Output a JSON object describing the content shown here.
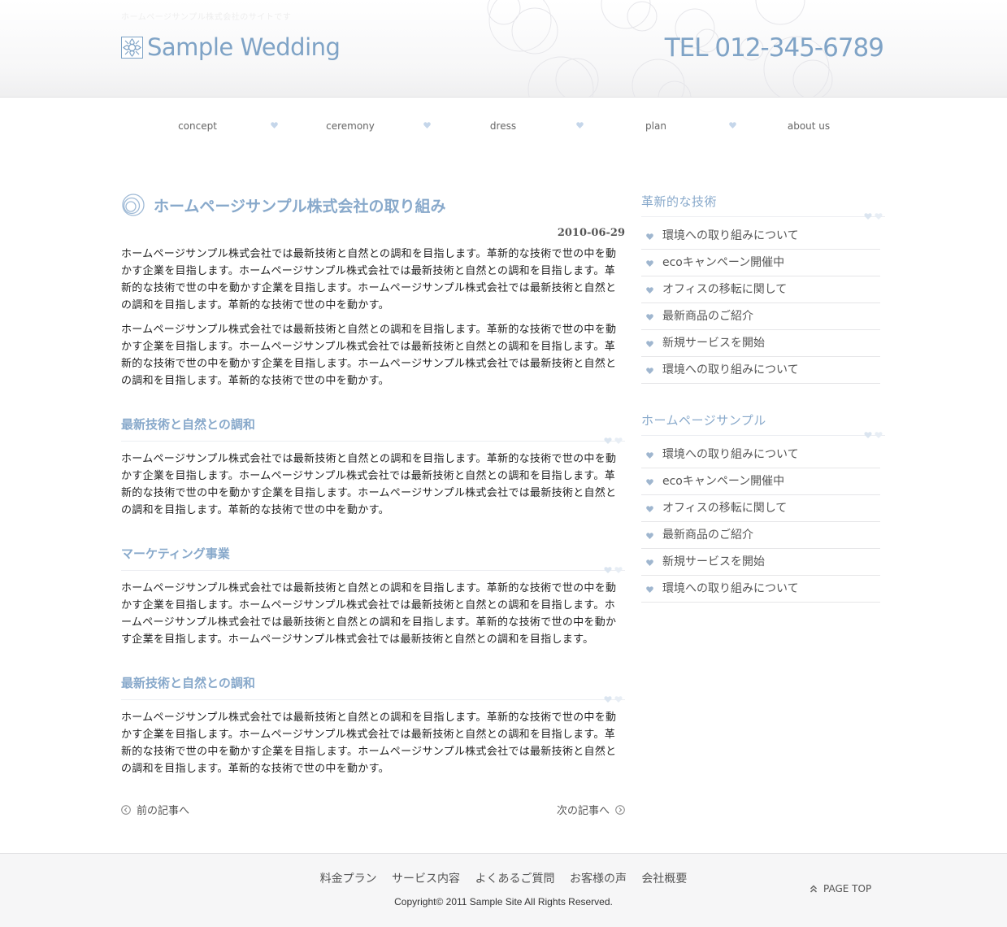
{
  "header": {
    "tagline": "ホームページサンプル株式会社のサイトです",
    "logo_text": "Sample Wedding",
    "tel": "TEL 012-345-6789"
  },
  "nav": {
    "items": [
      {
        "label": "concept"
      },
      {
        "label": "ceremony"
      },
      {
        "label": "dress"
      },
      {
        "label": "plan"
      },
      {
        "label": "about us"
      }
    ]
  },
  "article": {
    "title": "ホームページサンプル株式会社の取り組み",
    "date": "2010-06-29",
    "intro_paragraphs": [
      "ホームページサンプル株式会社では最新技術と自然との調和を目指します。革新的な技術で世の中を動かす企業を目指します。ホームページサンプル株式会社では最新技術と自然との調和を目指します。革新的な技術で世の中を動かす企業を目指します。ホームページサンプル株式会社では最新技術と自然との調和を目指します。革新的な技術で世の中を動かす。",
      "ホームページサンプル株式会社では最新技術と自然との調和を目指します。革新的な技術で世の中を動かす企業を目指します。ホームページサンプル株式会社では最新技術と自然との調和を目指します。革新的な技術で世の中を動かす企業を目指します。ホームページサンプル株式会社では最新技術と自然との調和を目指します。革新的な技術で世の中を動かす。"
    ],
    "sections": [
      {
        "heading": "最新技術と自然との調和",
        "body": "ホームページサンプル株式会社では最新技術と自然との調和を目指します。革新的な技術で世の中を動かす企業を目指します。ホームページサンプル株式会社では最新技術と自然との調和を目指します。革新的な技術で世の中を動かす企業を目指します。ホームページサンプル株式会社では最新技術と自然との調和を目指します。革新的な技術で世の中を動かす。"
      },
      {
        "heading": "マーケティング事業",
        "body": "ホームページサンプル株式会社では最新技術と自然との調和を目指します。革新的な技術で世の中を動かす企業を目指します。ホームページサンプル株式会社では最新技術と自然との調和を目指します。ホームページサンプル株式会社では最新技術と自然との調和を目指します。革新的な技術で世の中を動かす企業を目指します。ホームページサンプル株式会社では最新技術と自然との調和を目指します。"
      },
      {
        "heading": "最新技術と自然との調和",
        "body": "ホームページサンプル株式会社では最新技術と自然との調和を目指します。革新的な技術で世の中を動かす企業を目指します。ホームページサンプル株式会社では最新技術と自然との調和を目指します。革新的な技術で世の中を動かす企業を目指します。ホームページサンプル株式会社では最新技術と自然との調和を目指します。革新的な技術で世の中を動かす。"
      }
    ]
  },
  "pager": {
    "prev_label": "前の記事へ",
    "next_label": "次の記事へ"
  },
  "sidebar": {
    "sections": [
      {
        "heading": "革新的な技術",
        "items": [
          "環境への取り組みについて",
          "ecoキャンペーン開催中",
          "オフィスの移転に関して",
          "最新商品のご紹介",
          "新規サービスを開始",
          "環境への取り組みについて"
        ]
      },
      {
        "heading": "ホームページサンプル",
        "items": [
          "環境への取り組みについて",
          "ecoキャンペーン開催中",
          "オフィスの移転に関して",
          "最新商品のご紹介",
          "新規サービスを開始",
          "環境への取り組みについて"
        ]
      }
    ]
  },
  "footer": {
    "links": [
      "料金プラン",
      "サービス内容",
      "よくあるご質問",
      "お客様の声",
      "会社概要"
    ],
    "copyright": "Copyright© 2011 Sample Site All Rights Reserved.",
    "page_top": "PAGE TOP"
  },
  "colors": {
    "accent": "#88a9cb",
    "heart": "#c5d6ea",
    "text": "#222222"
  }
}
